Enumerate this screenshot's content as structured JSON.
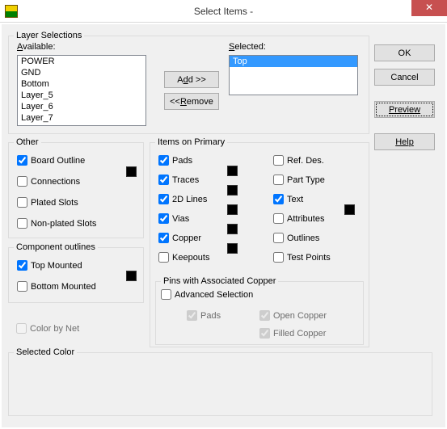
{
  "window": {
    "title": "Select Items -",
    "close": "✕"
  },
  "buttons": {
    "ok": "OK",
    "cancel": "Cancel",
    "preview": "Preview",
    "help": "Help",
    "add": "Add >>",
    "remove": "<<Remove"
  },
  "layer_section": {
    "legend": "Layer Selections",
    "available_label": "Available:",
    "selected_label": "Selected:",
    "available_items": [
      "POWER",
      "GND",
      "Bottom",
      "Layer_5",
      "Layer_6",
      "Layer_7"
    ],
    "selected_items": [
      "Top"
    ]
  },
  "other": {
    "legend": "Other",
    "board_outline": "Board Outline",
    "connections": "Connections",
    "plated_slots": "Plated Slots",
    "nonplated_slots": "Non-plated Slots"
  },
  "comp_outlines": {
    "legend": "Component outlines",
    "top_mounted": "Top Mounted",
    "bottom_mounted": "Bottom Mounted"
  },
  "items_primary": {
    "legend": "Items on Primary",
    "pads": "Pads",
    "traces": "Traces",
    "lines2d": "2D Lines",
    "vias": "Vias",
    "copper": "Copper",
    "keepouts": "Keepouts",
    "refdes": "Ref. Des.",
    "parttype": "Part Type",
    "text": "Text",
    "attributes": "Attributes",
    "outlines": "Outlines",
    "testpoints": "Test Points"
  },
  "pins_copper": {
    "legend": "Pins with Associated Copper",
    "advanced": "Advanced Selection",
    "pads": "Pads",
    "open_copper": "Open Copper",
    "filled_copper": "Filled Copper"
  },
  "misc": {
    "color_by_net": "Color by Net",
    "selected_color": "Selected Color"
  }
}
